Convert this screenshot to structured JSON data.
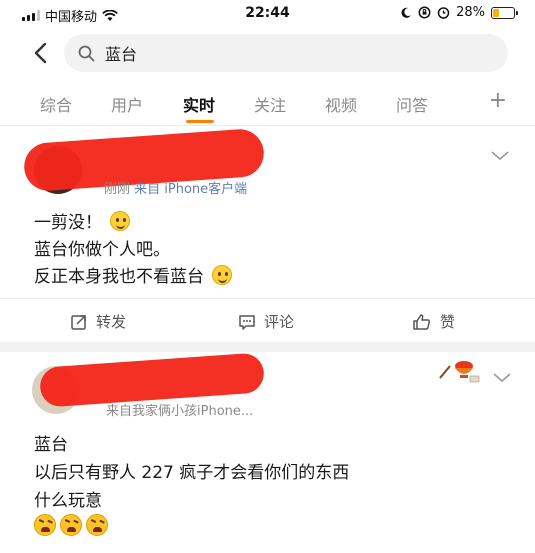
{
  "status_bar": {
    "carrier": "中国移动",
    "time": "22:44",
    "battery": "28%",
    "battery_level": 0.28
  },
  "search": {
    "query": "蓝台"
  },
  "tabs": [
    {
      "label": "综合"
    },
    {
      "label": "用户"
    },
    {
      "label": "实时"
    },
    {
      "label": "关注"
    },
    {
      "label": "视频"
    },
    {
      "label": "问答"
    }
  ],
  "tab_plus": "+",
  "posts": [
    {
      "time": "刚刚",
      "source": "来自 iPhone客户端",
      "lines": [
        "一剪没！",
        "蓝台你做个人吧。",
        "反正本身我也不看蓝台"
      ],
      "actions": {
        "repost": "转发",
        "comment": "评论",
        "like": "赞"
      }
    },
    {
      "source": "来自我家俩小孩iPhone...",
      "lines": [
        "蓝台",
        "以后只有野人 227 疯子才会看你们的东西",
        "什么玩意"
      ]
    }
  ],
  "colors": {
    "accent": "#ff8200",
    "redaction": "#f4271b",
    "source_link": "#5d7fb0"
  }
}
